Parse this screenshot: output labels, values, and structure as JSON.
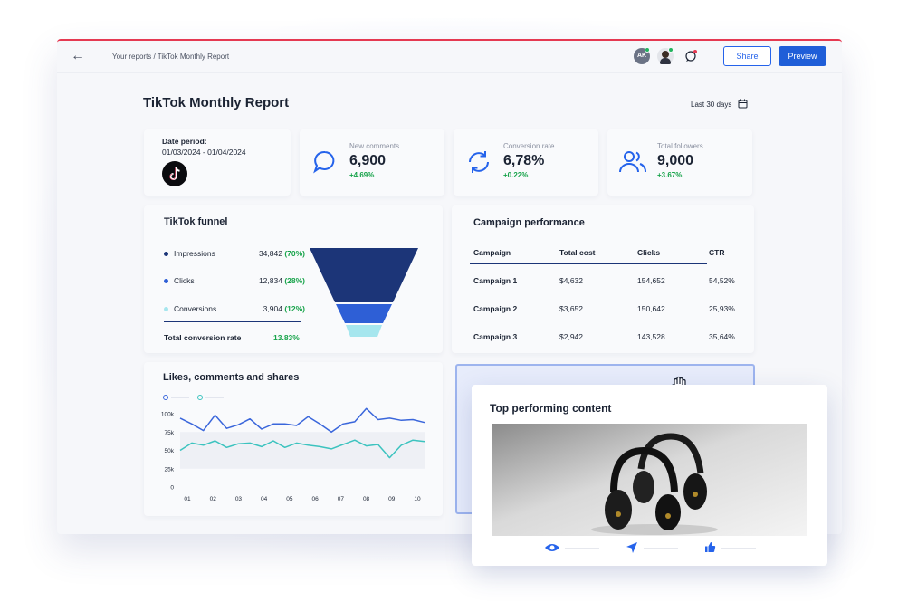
{
  "header": {
    "breadcrumb": "Your reports / TikTok Monthly Report",
    "avatar_initials": "AK",
    "share_label": "Share",
    "preview_label": "Preview"
  },
  "report": {
    "title": "TikTok Monthly Report",
    "range_label": "Last 30 days"
  },
  "date_card": {
    "label": "Date period:",
    "value": "01/03/2024 - 01/04/2024"
  },
  "kpis": [
    {
      "label": "New comments",
      "value": "6,900",
      "change": "+4.69%",
      "icon": "comment-icon"
    },
    {
      "label": "Conversion rate",
      "value": "6,78%",
      "change": "+0.22%",
      "icon": "refresh-icon"
    },
    {
      "label": "Total followers",
      "value": "9,000",
      "change": "+3.67%",
      "icon": "users-icon"
    }
  ],
  "funnel": {
    "title": "TikTok funnel",
    "rows": [
      {
        "label": "Impressions",
        "value": "34,842",
        "pct": "(70%)",
        "color": "#1c3578"
      },
      {
        "label": "Clicks",
        "value": "12,834",
        "pct": "(28%)",
        "color": "#2e5fd6"
      },
      {
        "label": "Conversions",
        "value": "3,904",
        "pct": "(12%)",
        "color": "#a6e6ee"
      }
    ],
    "total_label": "Total conversion rate",
    "total_value": "13.83%"
  },
  "campaign": {
    "title": "Campaign performance",
    "columns": [
      "Campaign",
      "Total cost",
      "Clicks",
      "CTR"
    ],
    "rows": [
      [
        "Campaign 1",
        "$4,632",
        "154,652",
        "54,52%"
      ],
      [
        "Campaign 2",
        "$3,652",
        "150,642",
        "25,93%"
      ],
      [
        "Campaign 3",
        "$2,942",
        "143,528",
        "35,64%"
      ]
    ]
  },
  "likes": {
    "title": "Likes, comments and shares"
  },
  "chart_data": {
    "type": "line",
    "x": [
      "01",
      "02",
      "03",
      "04",
      "05",
      "06",
      "07",
      "08",
      "09",
      "10"
    ],
    "y_ticks": [
      "100k",
      "75k",
      "50k",
      "25k",
      "0"
    ],
    "ylim": [
      0,
      100000
    ],
    "series": [
      {
        "color": "#3a66db",
        "values": [
          94000,
          86000,
          77000,
          98000,
          80000,
          85000,
          93000,
          79000,
          86000,
          86000,
          84000,
          96000,
          86000,
          75000,
          86000,
          89000,
          107000,
          92000,
          94000,
          91000,
          92000,
          88000
        ]
      },
      {
        "color": "#3cc3bf",
        "values": [
          50000,
          60000,
          57000,
          63000,
          54000,
          59000,
          60000,
          55000,
          63000,
          54000,
          60000,
          57000,
          55000,
          52000,
          58000,
          64000,
          56000,
          58000,
          40000,
          57000,
          64000,
          62000
        ]
      }
    ]
  },
  "top_content": {
    "title": "Top performing content"
  }
}
